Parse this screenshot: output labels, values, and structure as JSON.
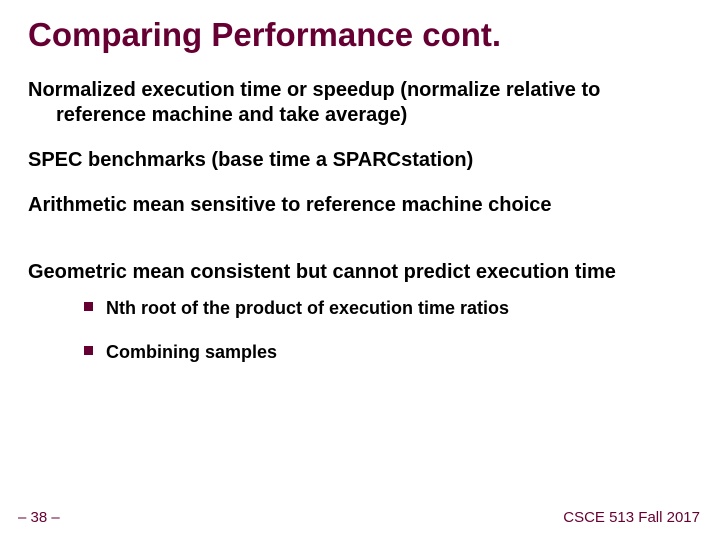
{
  "slide": {
    "title": "Comparing Performance cont.",
    "points": [
      "Normalized execution time or speedup (normalize relative to reference machine and take average)",
      "SPEC benchmarks (base time a SPARCstation)",
      "Arithmetic mean sensitive to reference machine choice",
      "Geometric mean consistent but cannot predict execution time"
    ],
    "subitems": [
      "Nth root of the product of execution time ratios",
      "Combining samples"
    ],
    "footer_left": "– 38 –",
    "footer_right": "CSCE 513 Fall 2017"
  }
}
